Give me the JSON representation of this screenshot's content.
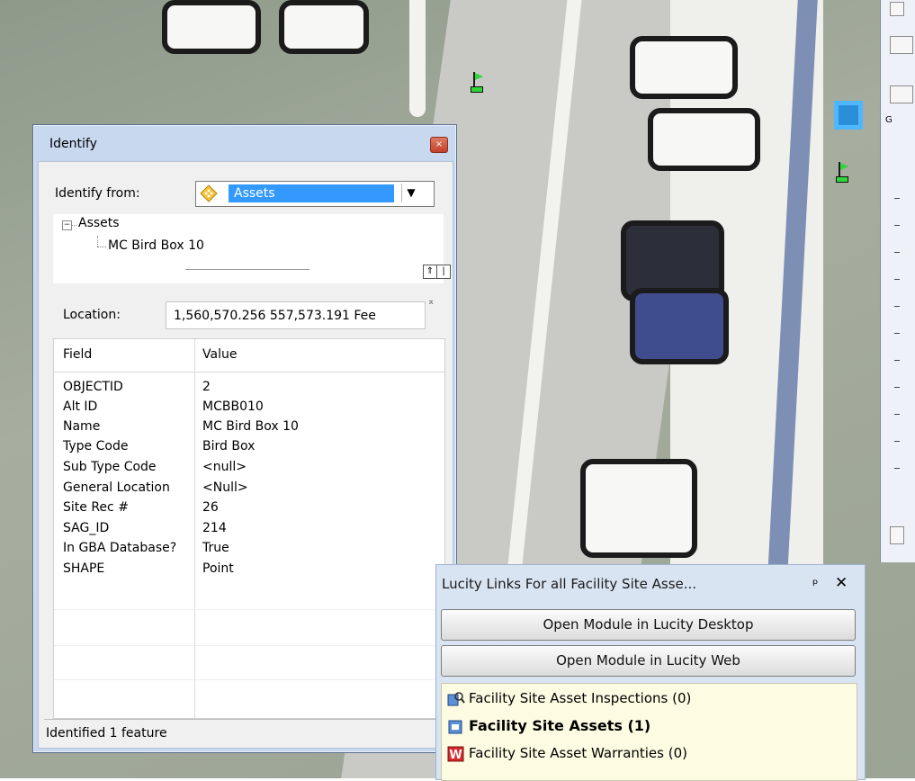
{
  "identify_window": {
    "title": "Identify",
    "identify_from_label": "Identify from:",
    "identify_from_value": "Assets",
    "tree": {
      "root": "Assets",
      "child": "MC Bird Box 10"
    },
    "location_label": "Location:",
    "location_value": "1,560,570.256  557,573.191 Fee",
    "columns": {
      "field": "Field",
      "value": "Value"
    },
    "rows": [
      {
        "field": "OBJECTID",
        "value": "2"
      },
      {
        "field": "Alt ID",
        "value": "MCBB010"
      },
      {
        "field": "Name",
        "value": "MC Bird Box 10"
      },
      {
        "field": "Type Code",
        "value": "Bird Box"
      },
      {
        "field": "Sub Type Code",
        "value": "<null>"
      },
      {
        "field": "General Location",
        "value": "<Null>"
      },
      {
        "field": "Site Rec #",
        "value": "26"
      },
      {
        "field": "SAG_ID",
        "value": "214"
      },
      {
        "field": "In GBA Database?",
        "value": "True"
      },
      {
        "field": "SHAPE",
        "value": "Point"
      }
    ],
    "status": "Identified 1 feature",
    "close_glyph": "×",
    "splitter_up_glyph": "⇑",
    "splitter_pipe_glyph": "|",
    "expand_glyph": "−",
    "dropdown_glyph": "▼"
  },
  "lucity_panel": {
    "title": "Lucity Links For all Facility Site Asse...",
    "pin_glyph": "ᵖ",
    "close_glyph": "✕",
    "desktop_button": "Open Module in Lucity Desktop",
    "web_button": "Open Module in Lucity Web",
    "links": [
      {
        "label": "Facility Site Asset Inspections (0)",
        "icon": "inspection-icon",
        "bold": false
      },
      {
        "label": "Facility Site Assets (1)",
        "icon": "asset-icon",
        "bold": true
      },
      {
        "label": "Facility Site Asset Warranties (0)",
        "icon": "warranty-icon",
        "bold": false
      }
    ]
  },
  "right_window": {
    "label": "G"
  },
  "colors": {
    "selection": "#3399ff",
    "flag_green": "#2fd63a",
    "marker_blue": "#2a8fd6",
    "links_bg": "#fdfbe2"
  }
}
